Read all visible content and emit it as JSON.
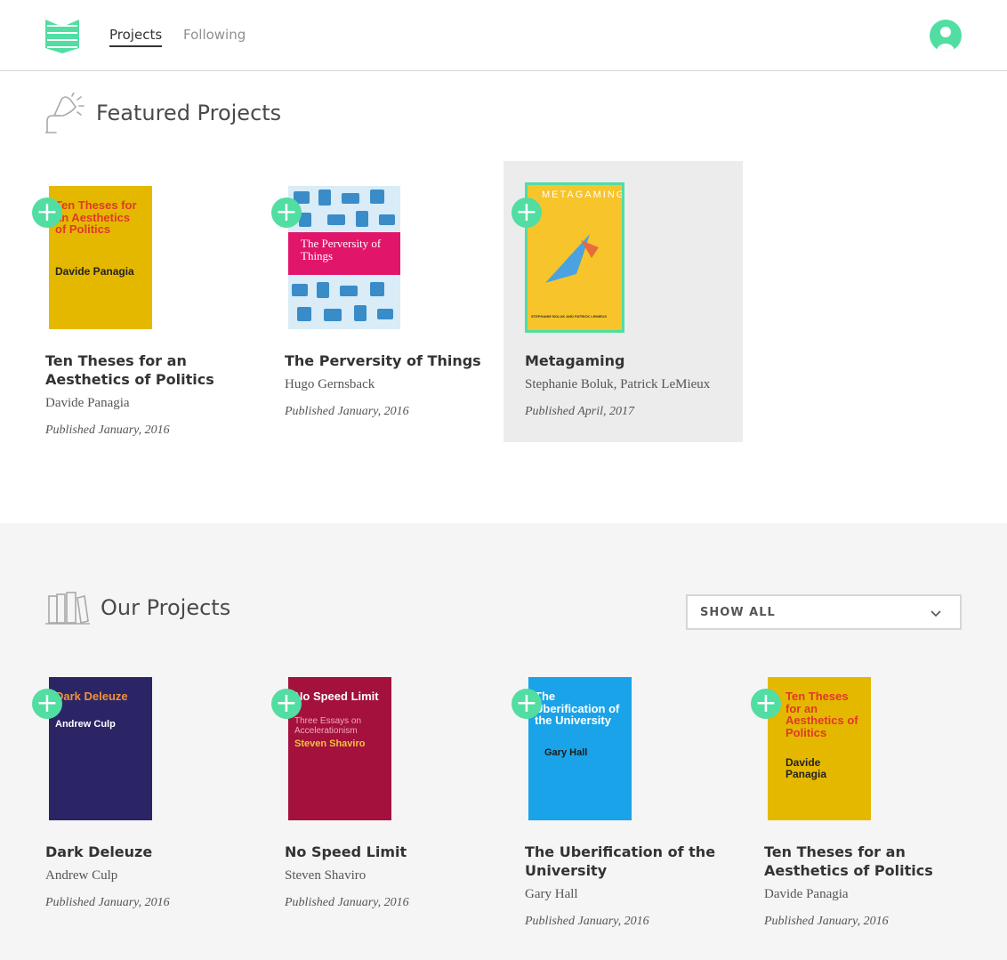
{
  "header": {
    "nav": [
      {
        "label": "Projects",
        "active": true
      },
      {
        "label": "Following",
        "active": false
      }
    ],
    "logo_icon": "manifold-logo-icon",
    "avatar_icon": "user-avatar-icon"
  },
  "featured": {
    "title": "Featured Projects",
    "icon": "desk-lamp-icon",
    "projects": [
      {
        "title": "Ten Theses for an Aesthetics of Politics",
        "author": "Davide Panagia",
        "date": "Published January, 2016",
        "cover_text": [
          "Ten Theses for an Aesthetics of Politics",
          "Davide Panagia"
        ]
      },
      {
        "title": "The Perversity of Things",
        "author": "Hugo Gernsback",
        "date": "Published January, 2016",
        "cover_text": [
          "The Perversity of Things"
        ]
      },
      {
        "title": "Metagaming",
        "author": "Stephanie Boluk, Patrick LeMieux",
        "date": "Published April, 2017",
        "cover_text": [
          "METAGAMING",
          "STEPHANIE BOLUK AND PATRICK LEMIEUX"
        ]
      }
    ]
  },
  "our": {
    "title": "Our Projects",
    "icon": "books-icon",
    "filter": {
      "label": "SHOW ALL",
      "icon": "chevron-down-icon"
    },
    "projects": [
      {
        "title": "Dark Deleuze",
        "author": "Andrew Culp",
        "date": "Published January, 2016",
        "cover_text": [
          "Dark Deleuze",
          "Andrew Culp"
        ]
      },
      {
        "title": "No Speed Limit",
        "author": "Steven Shaviro",
        "date": "Published January, 2016",
        "cover_text": [
          "No Speed Limit",
          "Three Essays on Accelerationism",
          "Steven Shaviro"
        ]
      },
      {
        "title": "The Uberification of the University",
        "author": "Gary Hall",
        "date": "Published January, 2016",
        "cover_text": [
          "The Uberification of the University",
          "Gary Hall"
        ]
      },
      {
        "title": "Ten Theses for an Aesthetics of Politics",
        "author": "Davide Panagia",
        "date": "Published January, 2016",
        "cover_text": [
          "Ten Theses for an Aesthetics of Politics",
          "Davide Panagia"
        ]
      }
    ]
  },
  "colors": {
    "accent": "#52dda2",
    "ten_theses_cover": "#e5b800",
    "ten_theses_text": "#e0382c",
    "dark_deleuze_cover": "#2b2566",
    "no_speed_cover": "#a3113c",
    "uberification_cover": "#1aa3e8",
    "metagaming_cover": "#f7c42b",
    "perversity_cover": "#d9ecf7"
  }
}
